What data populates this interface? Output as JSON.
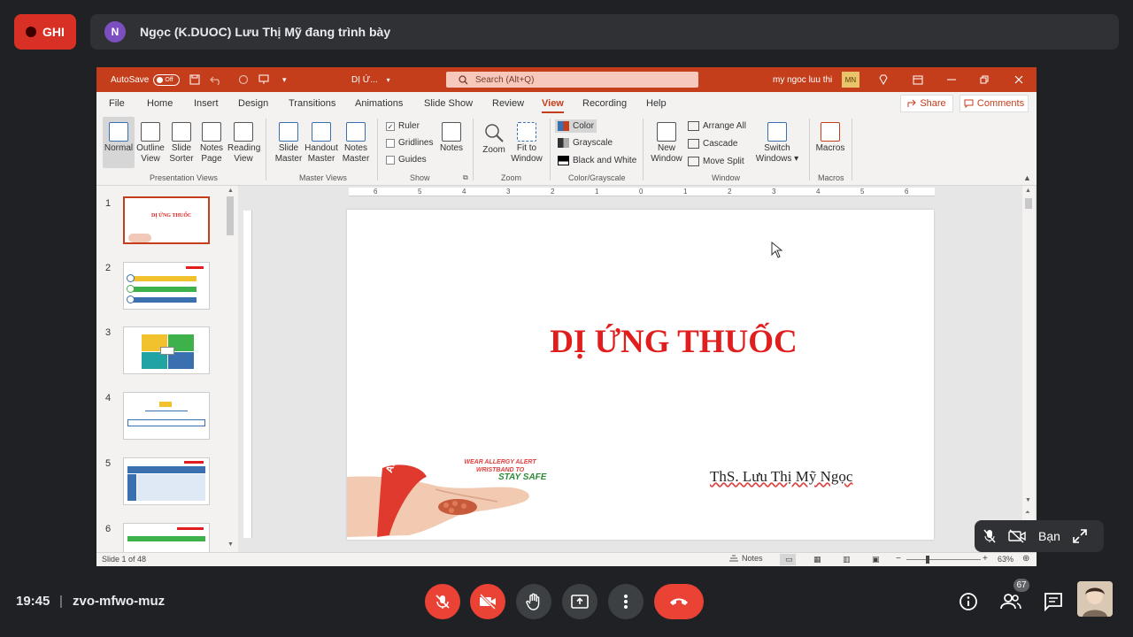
{
  "meet": {
    "recording_label": "GHI",
    "presenter_initial": "N",
    "presenter_text": "Ngọc (K.DUOC) Lưu Thị Mỹ đang trình bày",
    "time": "19:45",
    "divider": "|",
    "meeting_code": "zvo-mfwo-muz",
    "self_label": "Bạn",
    "participants_count": "67",
    "colors": {
      "record": "#d93025",
      "control_red": "#ea4335",
      "bar_bg": "#303134"
    }
  },
  "ppt": {
    "autosave_label": "AutoSave",
    "autosave_state": "Off",
    "file_name": "DỊ Ứ...",
    "search_placeholder": "Search (Alt+Q)",
    "user_name": "my ngoc luu thi",
    "user_initials": "MN",
    "tabs": [
      "File",
      "Home",
      "Insert",
      "Design",
      "Transitions",
      "Animations",
      "Slide Show",
      "Review",
      "View",
      "Recording",
      "Help"
    ],
    "active_tab": "View",
    "share_label": "Share",
    "comments_label": "Comments",
    "ribbon": {
      "presentation_views": [
        "Normal",
        "Outline View",
        "Slide Sorter",
        "Notes Page",
        "Reading View"
      ],
      "presentation_views_label": "Presentation Views",
      "master_views": [
        "Slide Master",
        "Handout Master",
        "Notes Master"
      ],
      "master_views_label": "Master Views",
      "show_checks": [
        {
          "label": "Ruler",
          "checked": true
        },
        {
          "label": "Gridlines",
          "checked": false
        },
        {
          "label": "Guides",
          "checked": false
        }
      ],
      "notes_label": "Notes",
      "show_label": "Show",
      "zoom_items": [
        "Zoom",
        "Fit to Window"
      ],
      "zoom_label": "Zoom",
      "color_items": [
        "Color",
        "Grayscale",
        "Black and White"
      ],
      "color_label": "Color/Grayscale",
      "window_items": [
        "New Window",
        "Arrange All",
        "Cascade",
        "Move Split",
        "Switch Windows"
      ],
      "window_label": "Window",
      "macros_items": [
        "Macros"
      ],
      "macros_label": "Macros"
    },
    "thumbnail_numbers": [
      "1",
      "2",
      "3",
      "4",
      "5",
      "6"
    ],
    "selected_slide": 1,
    "ruler_numbers": [
      "6",
      "5",
      "4",
      "3",
      "2",
      "1",
      "0",
      "1",
      "2",
      "3",
      "4",
      "5",
      "6"
    ],
    "slide": {
      "title": "DỊ ỨNG THUỐC",
      "author": "ThS. Lưu Thị Mỹ Ngọc",
      "wristband_text": "WEAR ALLERGY ALERT WRISTBAND TO",
      "stay_safe": "STAY SAFE",
      "wristband_word": "ALLERGY",
      "title_color": "#e01e1e"
    },
    "status": {
      "slide_info": "Slide 1 of 48",
      "notes_label": "Notes",
      "zoom": "63%"
    },
    "colors": {
      "accent": "#c43e1c"
    }
  }
}
